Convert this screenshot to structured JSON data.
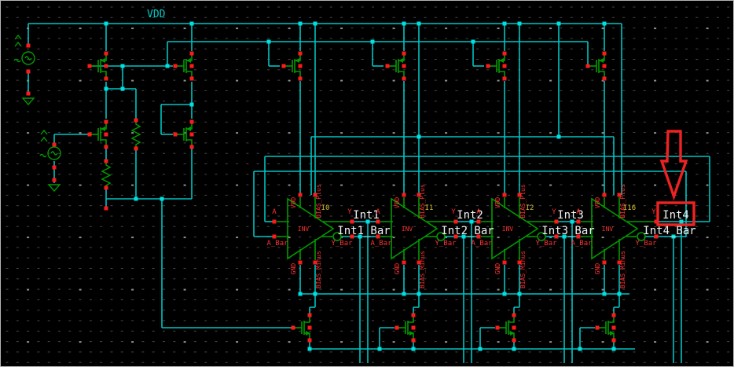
{
  "title": {
    "vdd_label": "VDD"
  },
  "colors": {
    "background": "#000000",
    "wire": "#00c4c4",
    "junction": "#00e0e0",
    "device": "#009b00",
    "pin": "#ff1a1a",
    "pin_text": "#ff3030",
    "net_text": "#f2f2f2",
    "instance_text": "#d8c832",
    "annotation": "#ee2222",
    "grid_dot": "#474747",
    "grid_dot_bright": "#8f8f8f"
  },
  "pin_labels": {
    "a": "A",
    "a_bar": "A_Bar",
    "y": "Y",
    "y_bar": "Y_Bar",
    "vdd": "VDD",
    "gnd": "GND",
    "bias_plus": "BIAS_Plus",
    "bias_minus": "BIAS_Minus"
  },
  "inverters": [
    {
      "instance": "I0",
      "cell": "INV",
      "net": "Int1",
      "net_bar": "Int1_Bar"
    },
    {
      "instance": "I1",
      "cell": "INV",
      "net": "Int2",
      "net_bar": "Int2_Bar"
    },
    {
      "instance": "I2",
      "cell": "INV",
      "net": "Int3",
      "net_bar": "Int3_Bar"
    },
    {
      "instance": "I16",
      "cell": "INV",
      "net": "Int4",
      "net_bar": "Int4_Bar"
    }
  ],
  "annotation": {
    "highlighted_net": "Int4"
  }
}
